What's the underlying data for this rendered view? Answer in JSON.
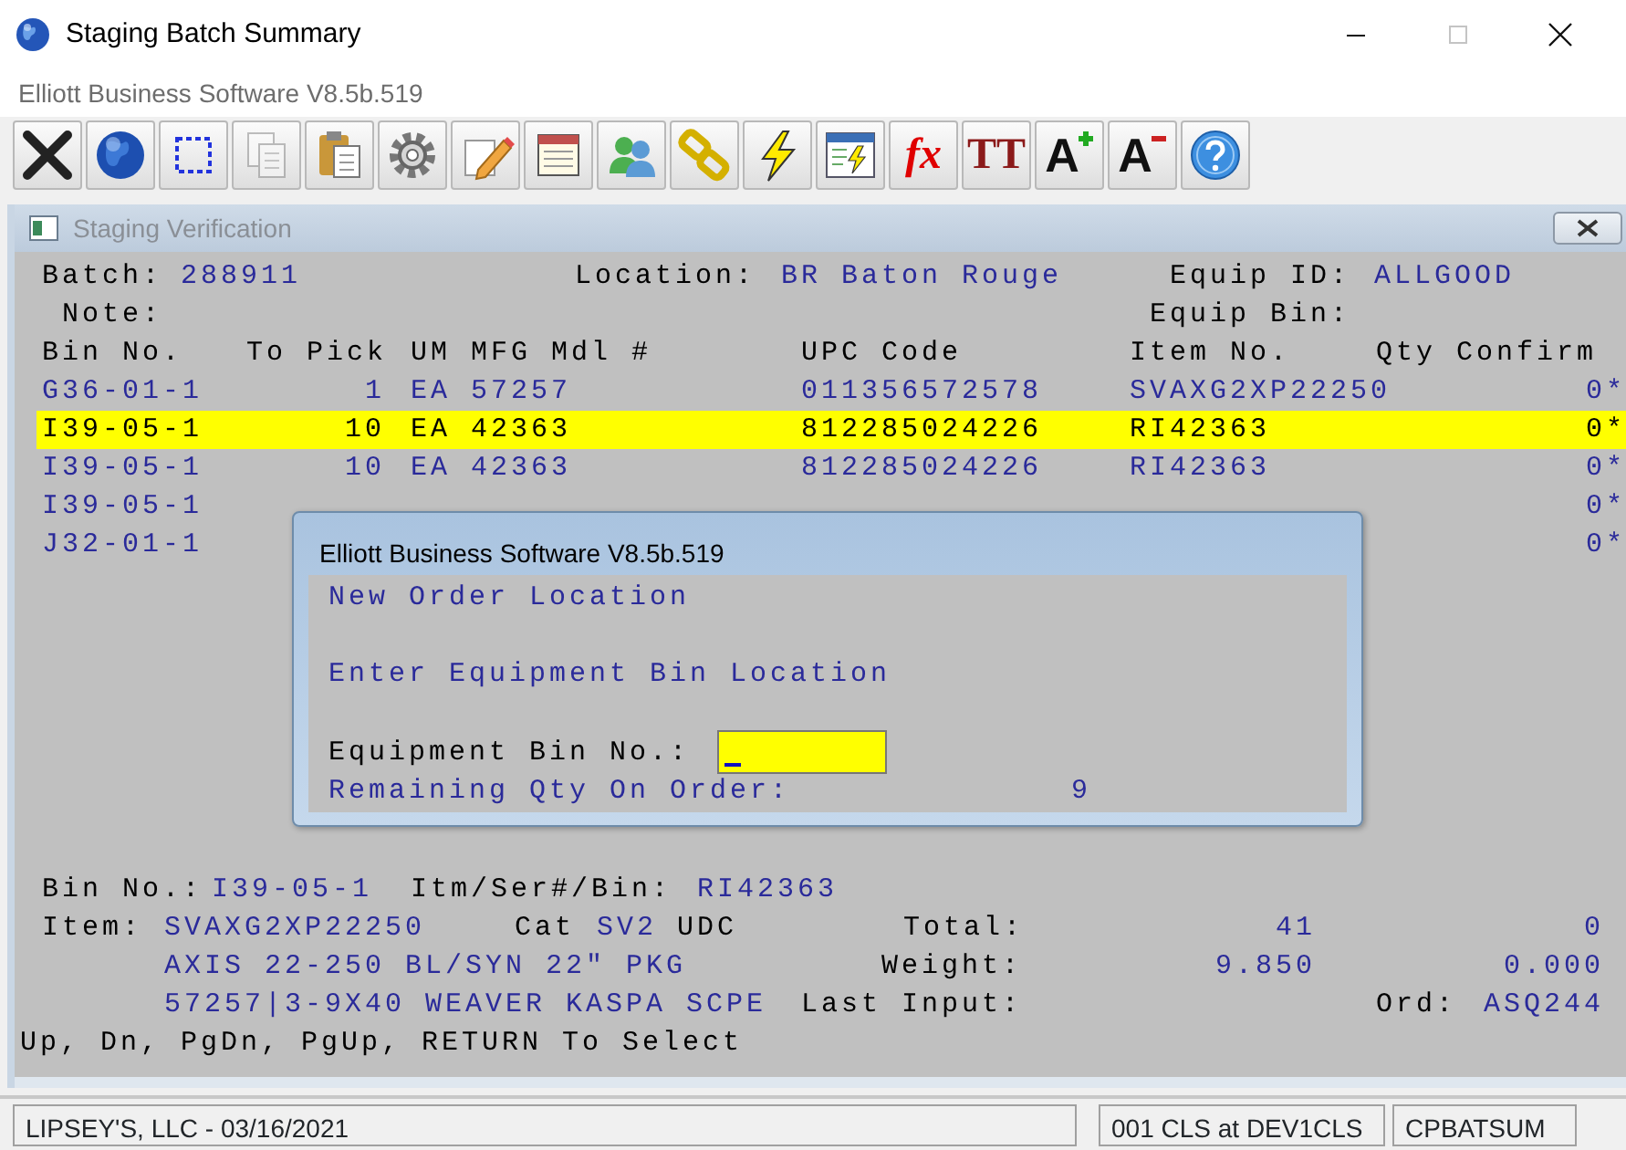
{
  "window": {
    "title": "Staging Batch Summary",
    "controls": [
      {
        "kind": "minimize",
        "disabled": false
      },
      {
        "kind": "maximize",
        "disabled": true
      },
      {
        "kind": "close",
        "disabled": false
      }
    ]
  },
  "app_caption": "Elliott Business Software V8.5b.519",
  "toolbar": [
    {
      "kind": "exit",
      "disabled": false
    },
    {
      "kind": "globe",
      "disabled": false
    },
    {
      "kind": "select",
      "disabled": false
    },
    {
      "kind": "copy",
      "disabled": true
    },
    {
      "kind": "paste",
      "disabled": false
    },
    {
      "kind": "settings",
      "disabled": false
    },
    {
      "kind": "edit",
      "disabled": false
    },
    {
      "kind": "list",
      "disabled": false
    },
    {
      "kind": "users",
      "disabled": false
    },
    {
      "kind": "link",
      "disabled": false
    },
    {
      "kind": "lightning",
      "disabled": false
    },
    {
      "kind": "window-lightning",
      "disabled": false
    },
    {
      "kind": "glyph",
      "glyph": "fx",
      "disabled": false
    },
    {
      "kind": "glyph",
      "glyph": "TT",
      "disabled": false
    },
    {
      "kind": "font-larger",
      "glyph": "A",
      "disabled": false
    },
    {
      "kind": "font-smaller",
      "glyph": "A",
      "disabled": false
    },
    {
      "kind": "help",
      "disabled": false
    }
  ],
  "child_window": {
    "title": "Staging Verification"
  },
  "header": {
    "batch_label": "Batch:",
    "batch": "288911",
    "location_label": "Location:",
    "location": "BR Baton Rouge",
    "equip_id_label": "Equip ID:",
    "equip_id": "ALLGOOD",
    "note_label": "Note:",
    "equip_bin_label": "Equip Bin:"
  },
  "columns": [
    "Bin No.",
    "To Pick",
    "UM",
    "MFG Mdl #",
    "UPC Code",
    "Item No.",
    "Qty Confirm"
  ],
  "rows": [
    {
      "bin": "G36-01-1",
      "to_pick": "1",
      "um": "EA",
      "mfg_mdl": "57257",
      "upc": "011356572578",
      "item_no": "SVAXG2XP22250",
      "qty_confirm": "0*",
      "selected": false
    },
    {
      "bin": "I39-05-1",
      "to_pick": "10",
      "um": "EA",
      "mfg_mdl": "42363",
      "upc": "812285024226",
      "item_no": "RI42363",
      "qty_confirm": "0*",
      "selected": true
    },
    {
      "bin": "I39-05-1",
      "to_pick": "10",
      "um": "EA",
      "mfg_mdl": "42363",
      "upc": "812285024226",
      "item_no": "RI42363",
      "qty_confirm": "0*",
      "selected": false
    },
    {
      "bin": "I39-05-1",
      "qty_confirm": "0*",
      "selected": false
    },
    {
      "bin": "J32-01-1",
      "qty_confirm": "0*",
      "selected": false
    }
  ],
  "detail": {
    "bin_label": "Bin No.:",
    "bin": "I39-05-1",
    "itm_label": "Itm/Ser#/Bin:",
    "itm": "RI42363",
    "item_label": "Item:",
    "item": "SVAXG2XP22250",
    "cat_label": "Cat",
    "cat": "SV2",
    "udc_label": "UDC",
    "total_label": "Total:",
    "total": "41",
    "total_2": "0",
    "description": "AXIS 22-250 BL/SYN 22\" PKG",
    "weight_label": "Weight:",
    "weight": "9.850",
    "weight_2": "0.000",
    "description_2": "57257|3-9X40 WEAVER KASPA SCPE",
    "last_input_label": "Last Input:",
    "ord_label": "Ord:",
    "ord": "ASQ244"
  },
  "hint": "Up, Dn, PgDn, PgUp, RETURN To Select",
  "dialog": {
    "title": "Elliott Business Software V8.5b.519",
    "heading": "New Order Location",
    "prompt": "Enter Equipment Bin Location",
    "field_label": "Equipment Bin No.:",
    "remaining_label": "Remaining Qty On Order:",
    "remaining": "9"
  },
  "status_bar": [
    "LIPSEY'S, LLC - 03/16/2021",
    "001 CLS at DEV1CLS",
    "CPBATSUM"
  ]
}
